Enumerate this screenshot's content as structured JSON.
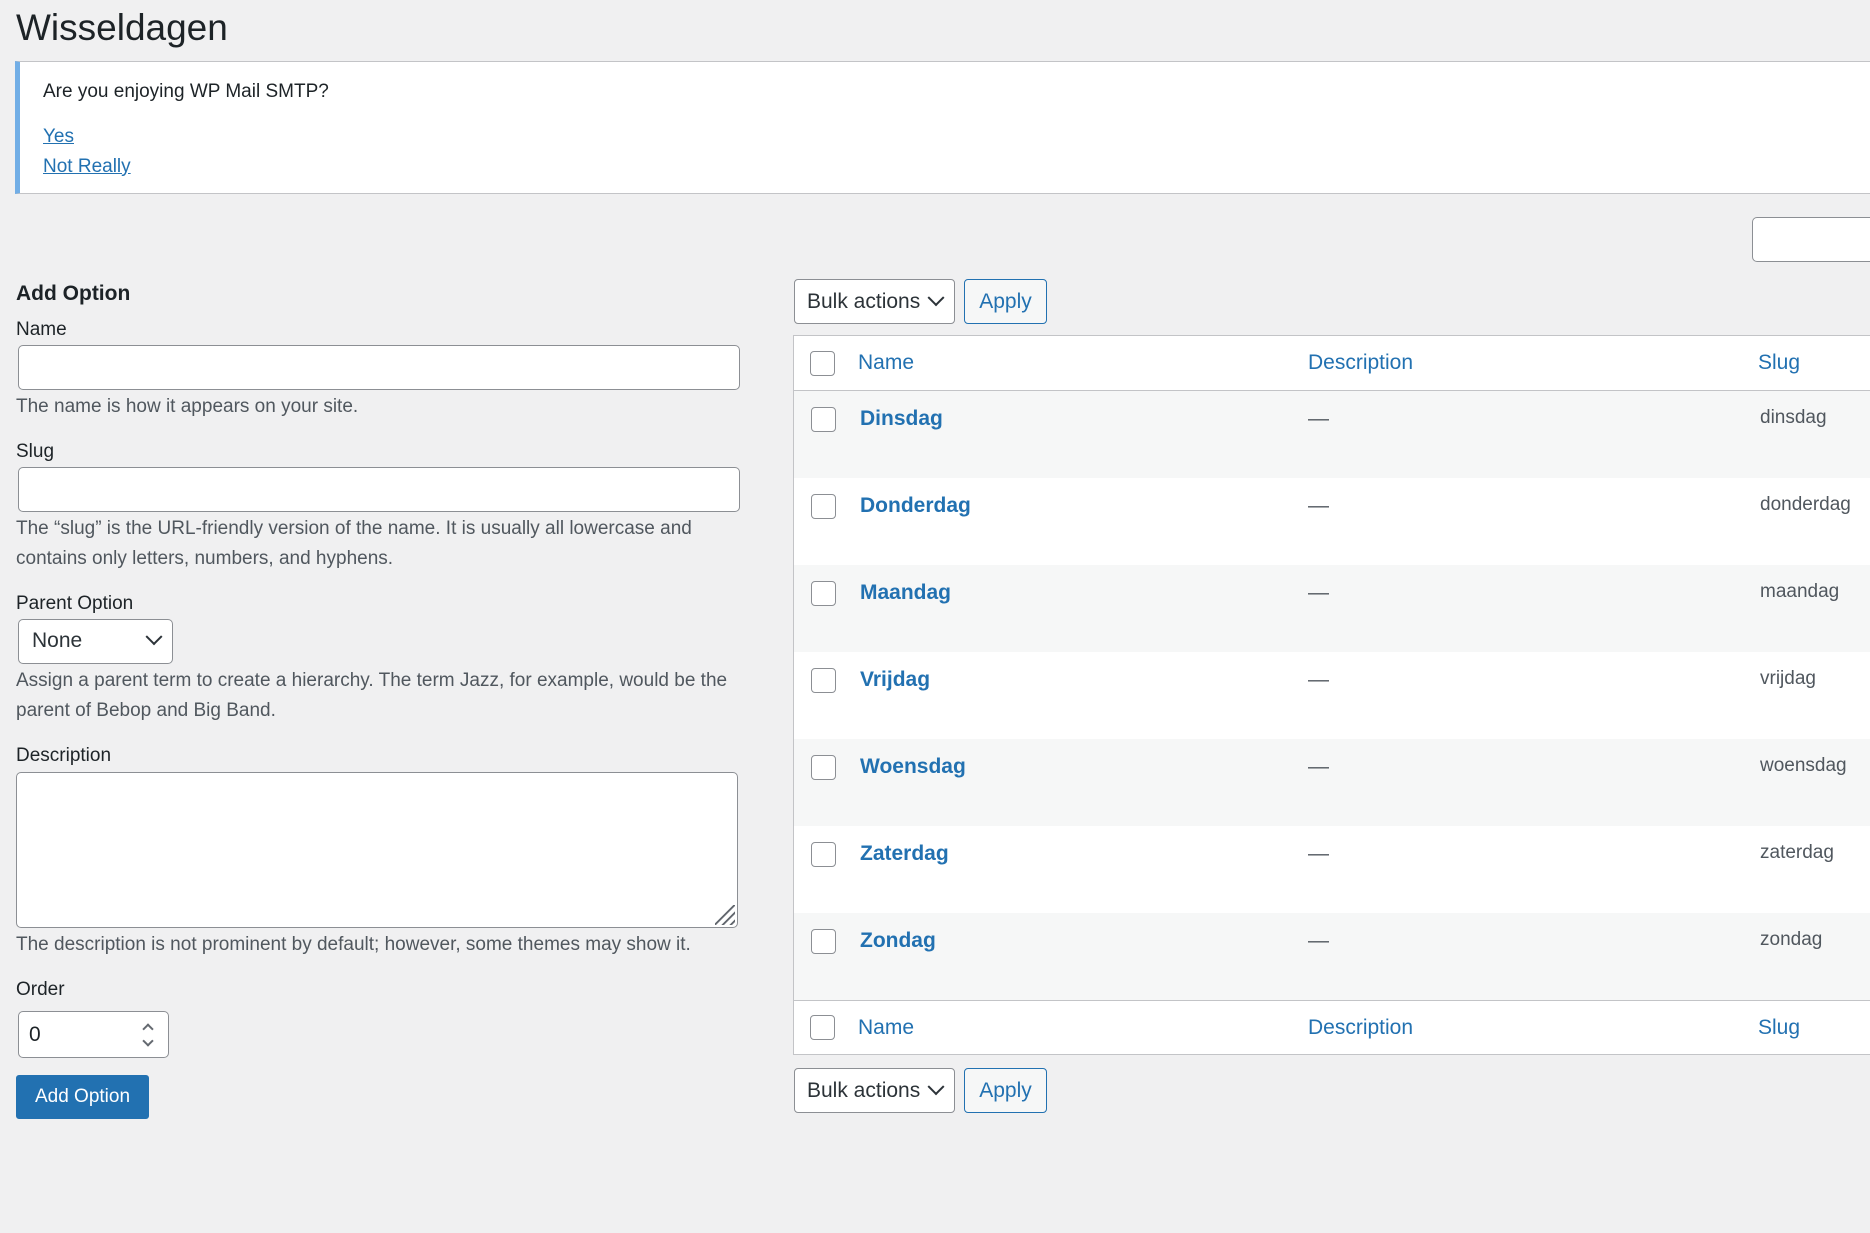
{
  "page": {
    "title": "Wisseldagen"
  },
  "notice": {
    "question": "Are you enjoying WP Mail SMTP?",
    "yes_label": "Yes",
    "no_label": "Not Really"
  },
  "form": {
    "heading": "Add Option",
    "name_label": "Name",
    "name_help": "The name is how it appears on your site.",
    "slug_label": "Slug",
    "slug_help": "The “slug” is the URL-friendly version of the name. It is usually all lowercase and contains only letters, numbers, and hyphens.",
    "parent_label": "Parent Option",
    "parent_value": "None",
    "parent_help": "Assign a parent term to create a hierarchy. The term Jazz, for example, would be the parent of Bebop and Big Band.",
    "description_label": "Description",
    "description_help": "The description is not prominent by default; however, some themes may show it.",
    "order_label": "Order",
    "order_value": "0",
    "submit_label": "Add Option"
  },
  "table": {
    "bulk_actions_label": "Bulk actions",
    "apply_label": "Apply",
    "columns": {
      "name": "Name",
      "description": "Description",
      "slug": "Slug"
    },
    "rows": [
      {
        "name": "Dinsdag",
        "description": "—",
        "slug": "dinsdag"
      },
      {
        "name": "Donderdag",
        "description": "—",
        "slug": "donderdag"
      },
      {
        "name": "Maandag",
        "description": "—",
        "slug": "maandag"
      },
      {
        "name": "Vrijdag",
        "description": "—",
        "slug": "vrijdag"
      },
      {
        "name": "Woensdag",
        "description": "—",
        "slug": "woensdag"
      },
      {
        "name": "Zaterdag",
        "description": "—",
        "slug": "zaterdag"
      },
      {
        "name": "Zondag",
        "description": "—",
        "slug": "zondag"
      }
    ]
  },
  "colors": {
    "accent": "#2271b1",
    "notice_border": "#72aee6",
    "background": "#f0f0f1"
  }
}
